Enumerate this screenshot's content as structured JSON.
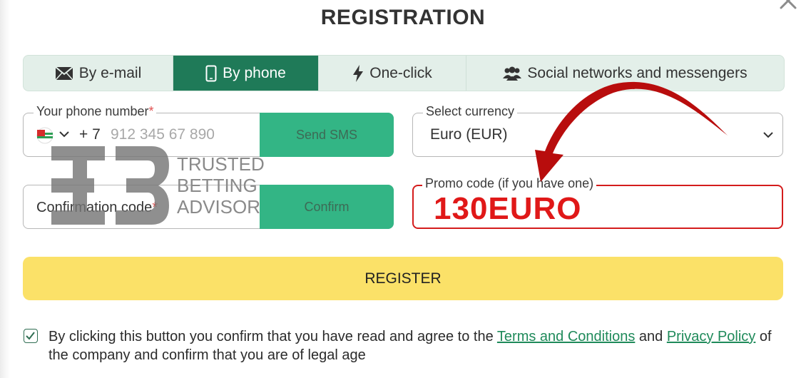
{
  "dialog": {
    "title": "REGISTRATION"
  },
  "tabs": [
    {
      "label": "By e-mail",
      "icon": "envelope-icon",
      "active": false
    },
    {
      "label": "By phone",
      "icon": "mobile-phone-icon",
      "active": true
    },
    {
      "label": "One-click",
      "icon": "lightning-icon",
      "active": false
    },
    {
      "label": "Social networks and messengers",
      "icon": "users-icon",
      "active": false
    }
  ],
  "phone": {
    "label": "Your phone number",
    "required_mark": "*",
    "country_code": "+ 7",
    "placeholder": "912 345 67 890",
    "send_button": "Send SMS"
  },
  "currency": {
    "label": "Select currency",
    "value": "Euro (EUR)"
  },
  "confirmation": {
    "label": "Confirmation code",
    "required_mark": "*",
    "button": "Confirm"
  },
  "promo": {
    "label": "Promo code (if you have one)",
    "value": "130EURO"
  },
  "register_button": "REGISTER",
  "terms": {
    "checked": true,
    "text_before": "By clicking this button you confirm that you have read and agree to the ",
    "link1": "Terms and Conditions",
    "text_middle": " and ",
    "link2": "Privacy Policy",
    "text_after": " of the company and confirm that you are of legal age"
  },
  "watermark": {
    "line1": "TRUSTED",
    "line2": "BETTING",
    "line3": "ADVISOR"
  },
  "colors": {
    "accent_green": "#1f7a58",
    "button_green": "#33b585",
    "register_yellow": "#fbe168",
    "promo_red": "#d41c1c"
  }
}
